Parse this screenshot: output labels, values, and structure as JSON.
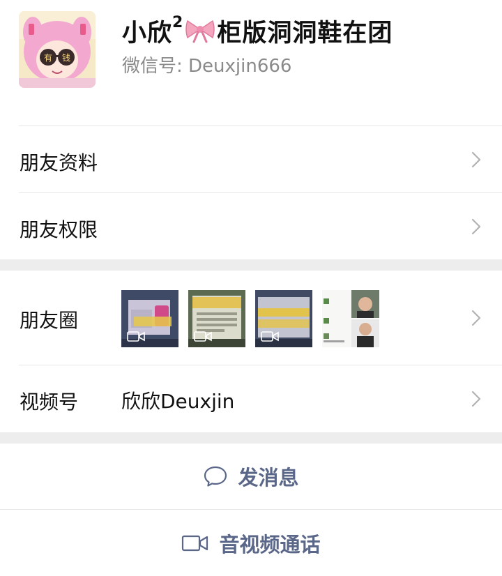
{
  "profile": {
    "name_prefix": "小欣",
    "name_sup": "2",
    "name_suffix": "柜版洞洞鞋在团",
    "wechat_id": "微信号:  Deuxjin666",
    "avatar_badge_left": "有",
    "avatar_badge_right": "钱"
  },
  "rows": {
    "friend_info": "朋友资料",
    "friend_permissions": "朋友权限",
    "moments": "朋友圈",
    "channels": "视频号",
    "channels_value": "欣欣Deuxjin"
  },
  "actions": {
    "message": "发消息",
    "av_call": "音视频通话"
  },
  "colors": {
    "action_text": "#5a6788",
    "separator": "#ededed",
    "secondary_text": "#8a8a8a"
  }
}
